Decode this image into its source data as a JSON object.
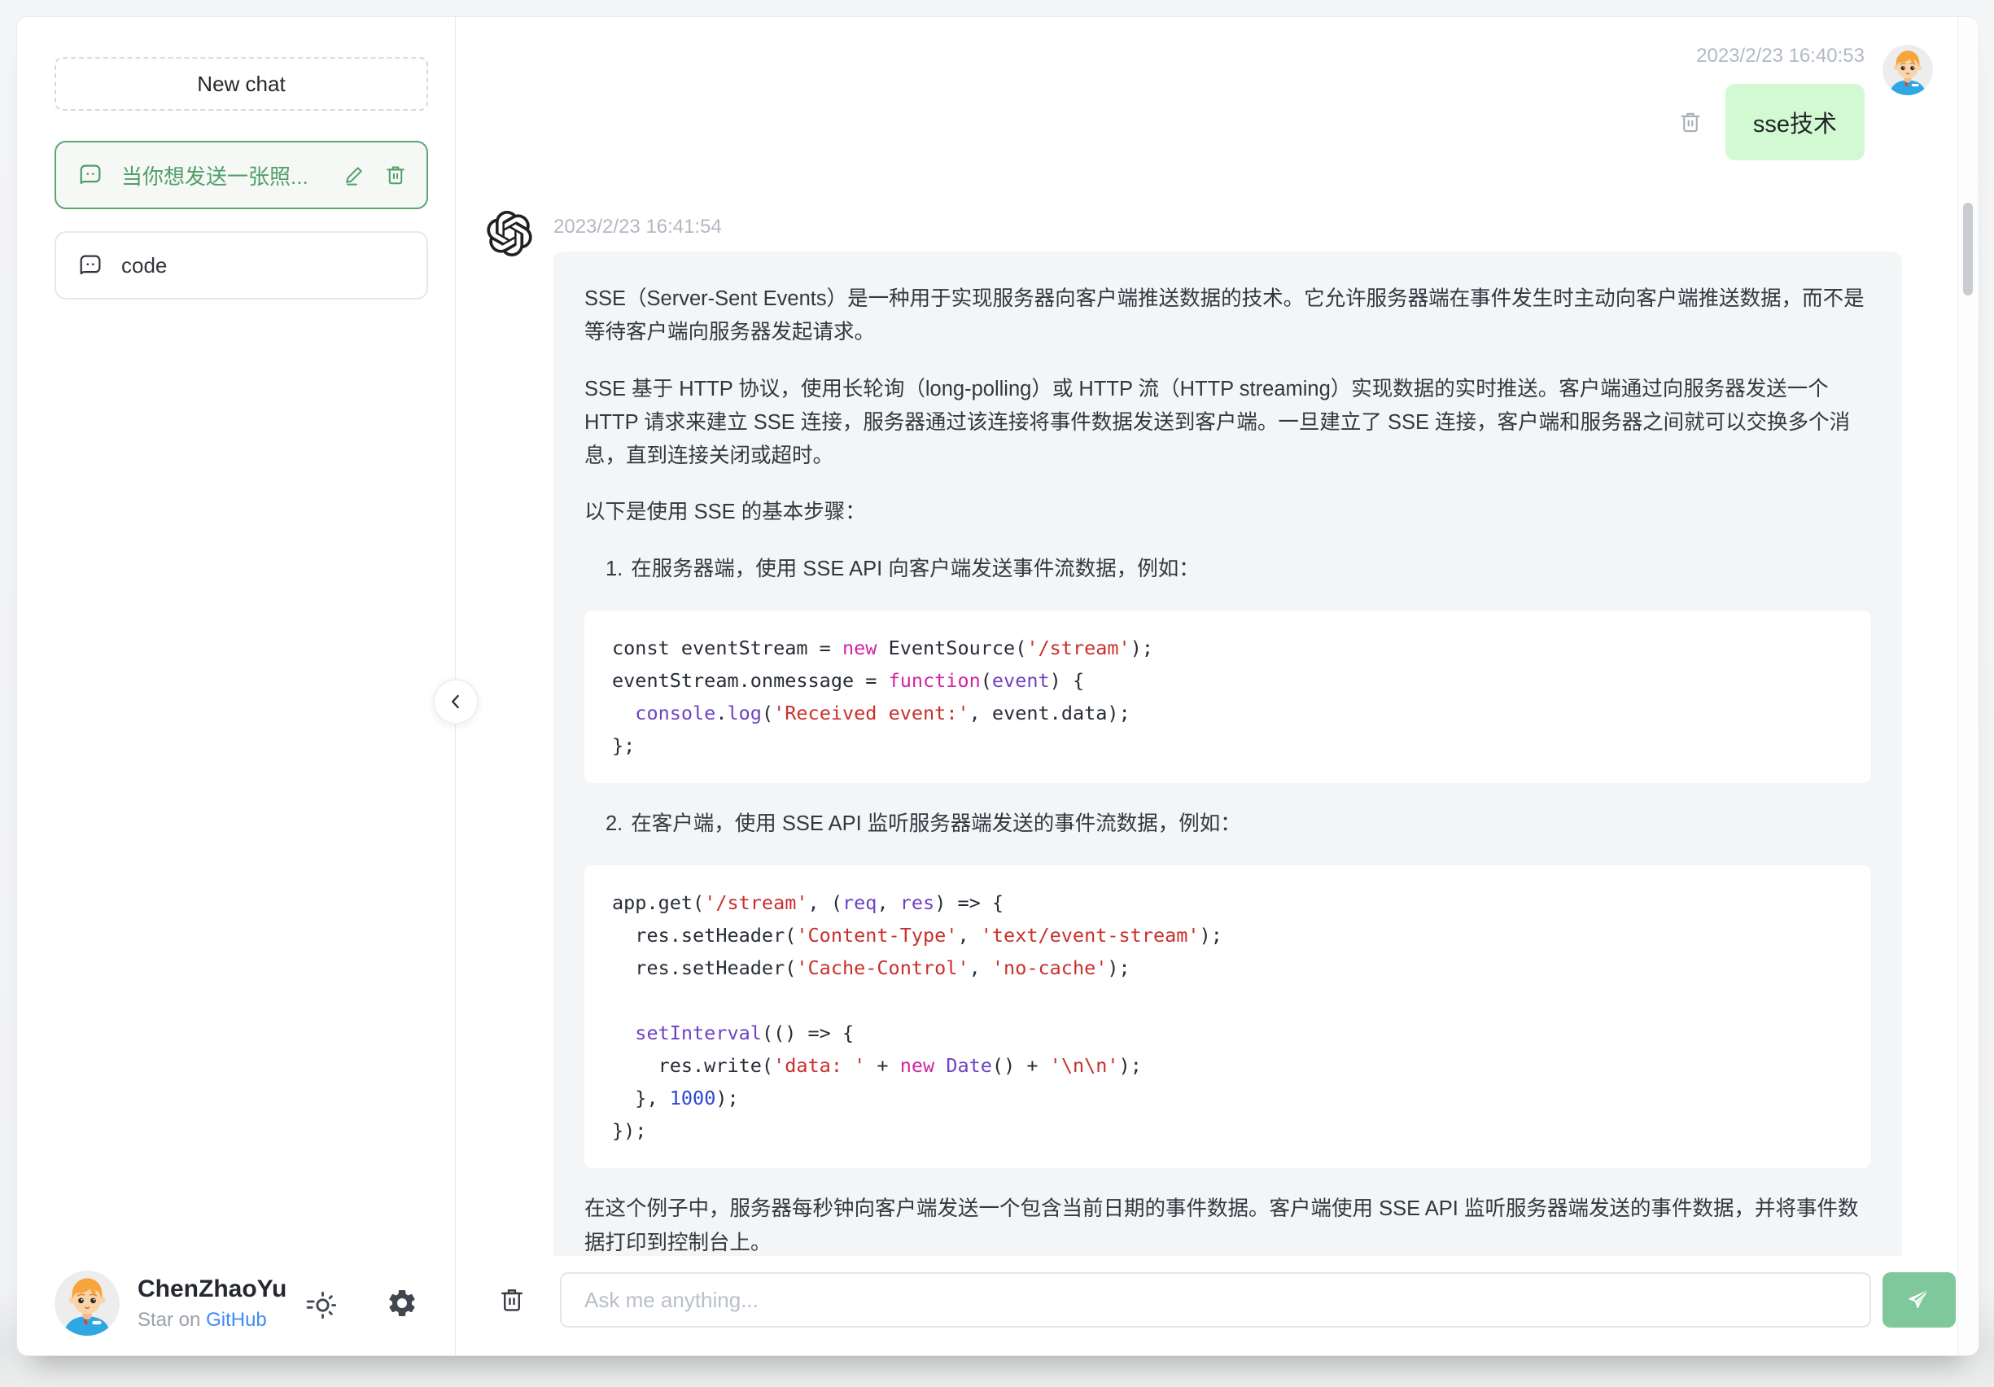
{
  "colors": {
    "accent_green": "#5ba571",
    "user_bubble_green": "#d2f9d1",
    "assistant_bubble_gray": "#f4f5f7",
    "send_button_green": "#7fc89c",
    "link_blue": "#3e8bf7",
    "timestamp_gray": "#b3b9c2",
    "code_keyword": "#cf26a2",
    "code_string": "#c9302c",
    "code_function": "#6f42c1",
    "code_number": "#2946d8"
  },
  "icons": {
    "chat_item": "chat-bubble-icon",
    "edit": "pencil-icon",
    "delete": "trash-icon",
    "theme": "theme-sun-icon",
    "settings": "gear-icon",
    "collapse": "chevron-left-icon",
    "assistant": "openai-logo-icon",
    "send": "paper-plane-icon"
  },
  "sidebar": {
    "new_chat_label": "New chat",
    "chats": [
      {
        "title": "当你想发送一张照...",
        "active": true
      },
      {
        "title": "code",
        "active": false
      }
    ],
    "user": {
      "name": "ChenZhaoYu",
      "star_text": "Star on",
      "star_link": "GitHub"
    }
  },
  "chat": {
    "user": {
      "timestamp": "2023/2/23 16:40:53",
      "text": "sse技术"
    },
    "assistant": {
      "timestamp": "2023/2/23 16:41:54",
      "blocks": [
        {
          "type": "p",
          "text": "SSE（Server-Sent Events）是一种用于实现服务器向客户端推送数据的技术。它允许服务器端在事件发生时主动向客户端推送数据，而不是等待客户端向服务器发起请求。"
        },
        {
          "type": "p",
          "text": "SSE 基于 HTTP 协议，使用长轮询（long-polling）或 HTTP 流（HTTP streaming）实现数据的实时推送。客户端通过向服务器发送一个 HTTP 请求来建立 SSE 连接，服务器通过该连接将事件数据发送到客户端。一旦建立了 SSE 连接，客户端和服务器之间就可以交换多个消息，直到连接关闭或超时。"
        },
        {
          "type": "p",
          "text": "以下是使用 SSE 的基本步骤："
        },
        {
          "type": "li",
          "num": "1.",
          "text": "在服务器端，使用 SSE API 向客户端发送事件流数据，例如："
        },
        {
          "type": "code",
          "lines": [
            [
              {
                "t": "const eventStream = "
              },
              {
                "t": "new",
                "c": "kw"
              },
              {
                "t": " EventSource("
              },
              {
                "t": "'/stream'",
                "c": "str"
              },
              {
                "t": ");"
              }
            ],
            [
              {
                "t": "eventStream.onmessage = "
              },
              {
                "t": "function",
                "c": "kw"
              },
              {
                "t": "("
              },
              {
                "t": "event",
                "c": "fn"
              },
              {
                "t": ") {"
              }
            ],
            [
              {
                "t": "  "
              },
              {
                "t": "console",
                "c": "fn"
              },
              {
                "t": "."
              },
              {
                "t": "log",
                "c": "fn"
              },
              {
                "t": "("
              },
              {
                "t": "'Received event:'",
                "c": "str"
              },
              {
                "t": ", event.data);"
              }
            ],
            [
              {
                "t": "};"
              }
            ]
          ]
        },
        {
          "type": "li",
          "num": "2.",
          "text": "在客户端，使用 SSE API 监听服务器端发送的事件流数据，例如："
        },
        {
          "type": "code",
          "lines": [
            [
              {
                "t": "app.get("
              },
              {
                "t": "'/stream'",
                "c": "str"
              },
              {
                "t": ", ("
              },
              {
                "t": "req",
                "c": "fn"
              },
              {
                "t": ", "
              },
              {
                "t": "res",
                "c": "fn"
              },
              {
                "t": ") => {"
              }
            ],
            [
              {
                "t": "  res.setHeader("
              },
              {
                "t": "'Content-Type'",
                "c": "str"
              },
              {
                "t": ", "
              },
              {
                "t": "'text/event-stream'",
                "c": "str"
              },
              {
                "t": ");"
              }
            ],
            [
              {
                "t": "  res.setHeader("
              },
              {
                "t": "'Cache-Control'",
                "c": "str"
              },
              {
                "t": ", "
              },
              {
                "t": "'no-cache'",
                "c": "str"
              },
              {
                "t": ");"
              }
            ],
            [
              {
                "t": ""
              }
            ],
            [
              {
                "t": "  "
              },
              {
                "t": "setInterval",
                "c": "fn"
              },
              {
                "t": "(() => {"
              }
            ],
            [
              {
                "t": "    res.write("
              },
              {
                "t": "'data: '",
                "c": "str"
              },
              {
                "t": " + "
              },
              {
                "t": "new",
                "c": "kw"
              },
              {
                "t": " "
              },
              {
                "t": "Date",
                "c": "fn"
              },
              {
                "t": "() + "
              },
              {
                "t": "'\\n\\n'",
                "c": "str"
              },
              {
                "t": ");"
              }
            ],
            [
              {
                "t": "  }, "
              },
              {
                "t": "1000",
                "c": "num"
              },
              {
                "t": ");"
              }
            ],
            [
              {
                "t": "});"
              }
            ]
          ]
        },
        {
          "type": "p",
          "text": "在这个例子中，服务器每秒钟向客户端发送一个包含当前日期的事件数据。客户端使用 SSE API 监听服务器端发送的事件数据，并将事件数据打印到控制台上。"
        }
      ]
    }
  },
  "footer": {
    "placeholder": "Ask me anything..."
  }
}
